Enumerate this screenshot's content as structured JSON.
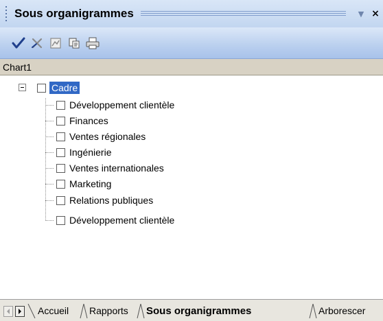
{
  "panel": {
    "title": "Sous organigrammes"
  },
  "toolbar": {
    "buttons": [
      {
        "icon": "checkmark-icon",
        "enabled": true
      },
      {
        "icon": "cross-icon",
        "enabled": false
      },
      {
        "icon": "chart-icon",
        "enabled": false
      },
      {
        "icon": "copy-icon",
        "enabled": true
      },
      {
        "icon": "print-icon",
        "enabled": true
      }
    ]
  },
  "chart_label": "Chart1",
  "tree": {
    "root": {
      "label": "Cadre",
      "checked": false,
      "expanded": true,
      "selected": true
    },
    "children": [
      {
        "label": "Développement clientèle",
        "checked": false
      },
      {
        "label": "Finances",
        "checked": false
      },
      {
        "label": "Ventes régionales",
        "checked": false
      },
      {
        "label": "Ingénierie",
        "checked": false
      },
      {
        "label": "Ventes internationales",
        "checked": false
      },
      {
        "label": "Marketing",
        "checked": false
      },
      {
        "label": "Relations publiques",
        "checked": false
      },
      {
        "label": "Développement clientèle",
        "checked": false
      }
    ]
  },
  "tabs": [
    {
      "label": "Accueil",
      "selected": false
    },
    {
      "label": "Rapports",
      "selected": false
    },
    {
      "label": "Sous organigrammes",
      "selected": true
    },
    {
      "label": "Arborescer",
      "selected": false
    }
  ],
  "colors": {
    "selection": "#3168c5",
    "accent_blue": "#1f3f8c"
  }
}
